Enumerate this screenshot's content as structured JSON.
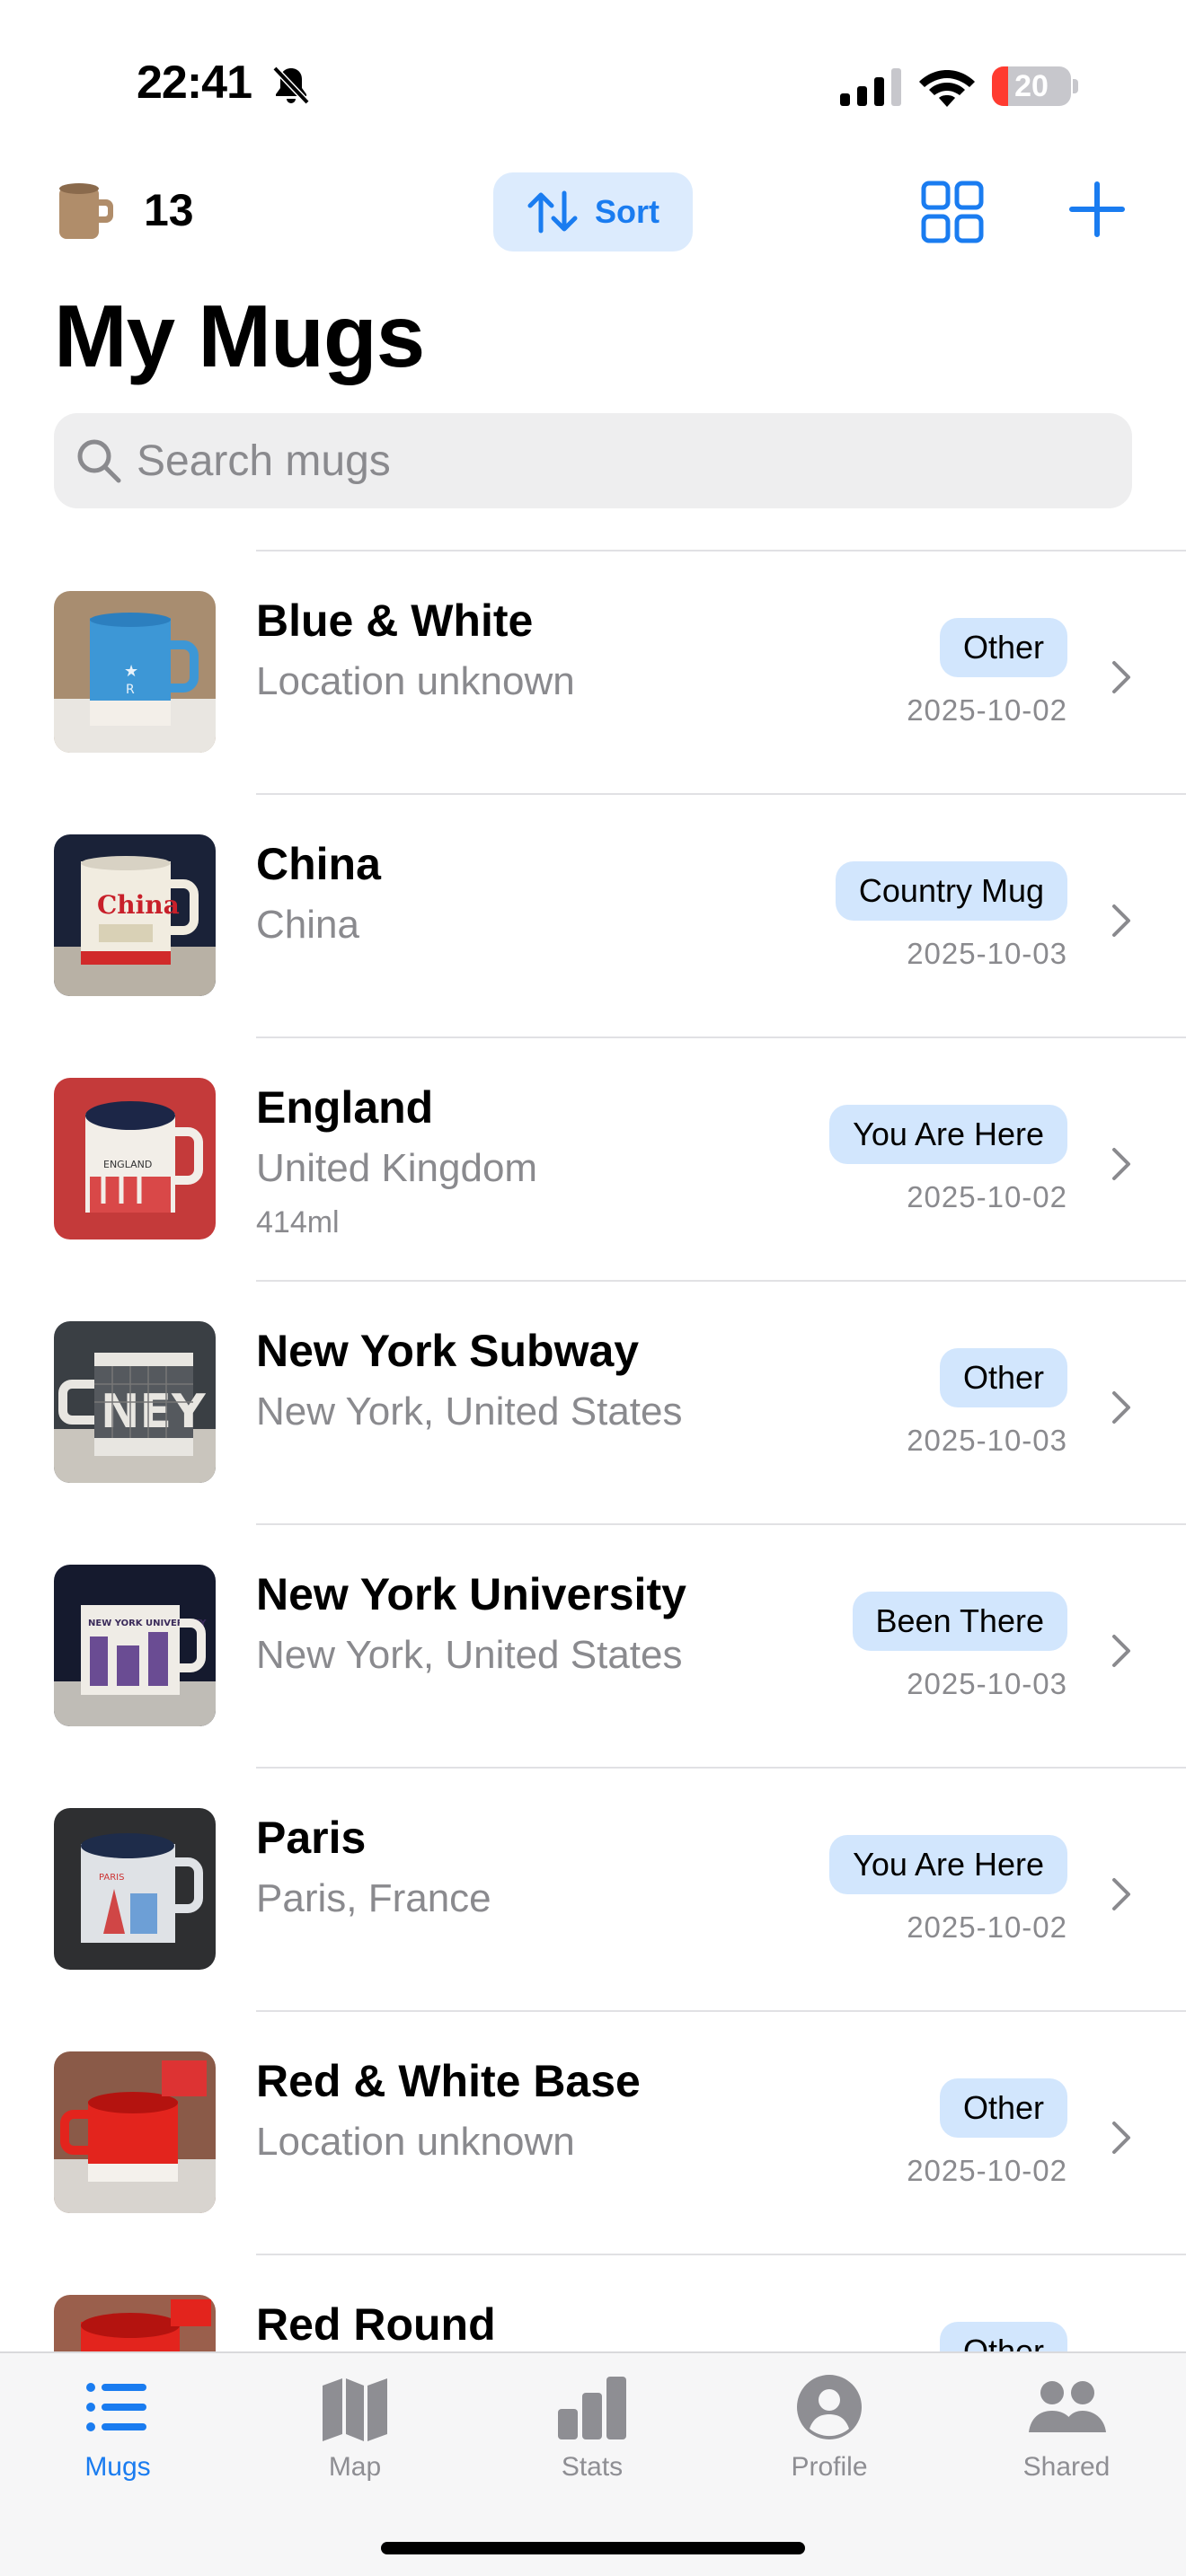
{
  "status_bar": {
    "time": "22:41",
    "battery": "20",
    "battery_level": 0.2,
    "icons": [
      "bell-slash-icon",
      "cellular-signal-icon",
      "wifi-icon",
      "battery-icon"
    ]
  },
  "toolbar": {
    "mug_count": "13",
    "sort_label": "Sort",
    "icons": [
      "mug-icon",
      "sort-arrows-icon",
      "grid-view-icon",
      "plus-icon"
    ]
  },
  "page": {
    "title": "My Mugs"
  },
  "search": {
    "placeholder": "Search mugs",
    "value": ""
  },
  "mugs": [
    {
      "name": "Blue & White",
      "location": "Location unknown",
      "capacity": "",
      "category": "Other",
      "date": "2025-10-02"
    },
    {
      "name": "China",
      "location": "China",
      "capacity": "",
      "category": "Country Mug",
      "date": "2025-10-03"
    },
    {
      "name": "England",
      "location": "United Kingdom",
      "capacity": "414ml",
      "category": "You Are Here",
      "date": "2025-10-02"
    },
    {
      "name": "New York Subway",
      "location": "New York, United States",
      "capacity": "",
      "category": "Other",
      "date": "2025-10-03"
    },
    {
      "name": "New York University",
      "location": "New York, United States",
      "capacity": "",
      "category": "Been There",
      "date": "2025-10-03"
    },
    {
      "name": "Paris",
      "location": "Paris, France",
      "capacity": "",
      "category": "You Are Here",
      "date": "2025-10-02"
    },
    {
      "name": "Red & White Base",
      "location": "Location unknown",
      "capacity": "",
      "category": "Other",
      "date": "2025-10-02"
    },
    {
      "name": "Red Round",
      "location": "",
      "capacity": "",
      "category": "Other",
      "date": ""
    }
  ],
  "tabbar": {
    "active": "Mugs",
    "tabs": [
      {
        "label": "Mugs",
        "icon": "list-icon"
      },
      {
        "label": "Map",
        "icon": "map-icon"
      },
      {
        "label": "Stats",
        "icon": "bar-chart-icon"
      },
      {
        "label": "Profile",
        "icon": "person-icon"
      },
      {
        "label": "Shared",
        "icon": "people-icon"
      }
    ]
  },
  "colors": {
    "accent": "#1a7cf0",
    "badge_bg": "#d2e6fd",
    "sort_bg": "#dcebfd",
    "secondary_text": "#8a8a8e",
    "battery_low": "#ff3b30"
  }
}
